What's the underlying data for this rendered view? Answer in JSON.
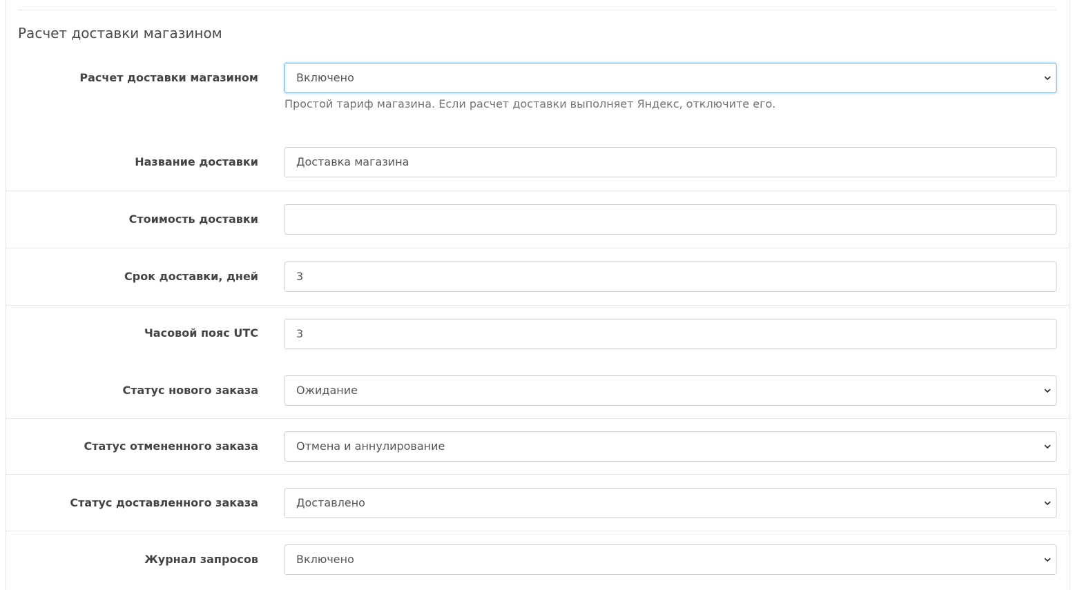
{
  "section": {
    "title": "Расчет доставки магазином"
  },
  "fields": {
    "shop_calc": {
      "label": "Расчет доставки магазином",
      "value": "Включено",
      "help": "Простой тариф магазина. Если расчет доставки выполняет Яндекс, отключите его."
    },
    "delivery_name": {
      "label": "Название доставки",
      "value": "Доставка магазина"
    },
    "delivery_cost": {
      "label": "Стоимость доставки",
      "value": ""
    },
    "delivery_days": {
      "label": "Срок доставки, дней",
      "value": "3"
    },
    "timezone": {
      "label": "Часовой пояс UTC",
      "value": "3"
    },
    "new_order_status": {
      "label": "Статус нового заказа",
      "value": "Ожидание"
    },
    "canceled_order_status": {
      "label": "Статус отмененного заказа",
      "value": "Отмена и аннулирование"
    },
    "delivered_order_status": {
      "label": "Статус доставленного заказа",
      "value": "Доставлено"
    },
    "request_log": {
      "label": "Журнал запросов",
      "value": "Включено"
    }
  },
  "icons": {
    "select_arrow": "chevron-down-icon"
  },
  "colors": {
    "focus_border": "#66afe9",
    "input_border": "#cccccc",
    "label": "#444444"
  }
}
